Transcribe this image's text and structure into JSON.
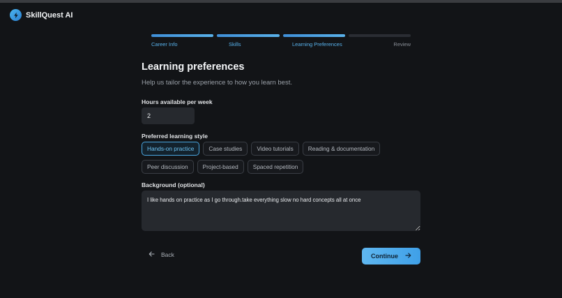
{
  "app": {
    "name": "SkillQuest AI"
  },
  "stepper": {
    "steps": [
      {
        "label": "Career Info",
        "complete": true
      },
      {
        "label": "Skills",
        "complete": true
      },
      {
        "label": "Learning Preferences",
        "complete": true
      },
      {
        "label": "Review",
        "complete": false
      }
    ]
  },
  "page": {
    "title": "Learning preferences",
    "subtitle": "Help us tailor the experience to how you learn best."
  },
  "hours": {
    "label": "Hours available per week",
    "value": "2"
  },
  "learning_style": {
    "label": "Preferred learning style",
    "options": [
      "Hands-on practice",
      "Case studies",
      "Video tutorials",
      "Reading & documentation",
      "Peer discussion",
      "Project-based",
      "Spaced repetition"
    ],
    "selected": "Hands-on practice"
  },
  "background": {
    "label": "Background (optional)",
    "value": "I like hands on practice as I go through.take everything slow no hard concepts all at once"
  },
  "nav": {
    "back_label": "Back",
    "continue_label": "Continue"
  },
  "colors": {
    "accent": "#4aa8e3",
    "background": "#121417"
  }
}
